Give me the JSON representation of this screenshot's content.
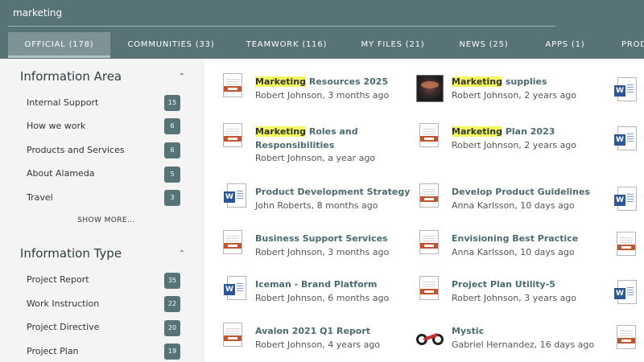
{
  "search": {
    "value": "marketing"
  },
  "tabs": [
    {
      "label": "OFFICIAL (178)"
    },
    {
      "label": "COMMUNITIES (33)"
    },
    {
      "label": "TEAMWORK (116)"
    },
    {
      "label": "MY FILES (21)"
    },
    {
      "label": "NEWS (25)"
    },
    {
      "label": "APPS (1)"
    },
    {
      "label": "PROD"
    }
  ],
  "sidebar": {
    "info_area": {
      "title": "Information Area",
      "items": [
        {
          "label": "Internal Support",
          "count": "15"
        },
        {
          "label": "How we work",
          "count": "6"
        },
        {
          "label": "Products and Services",
          "count": "6"
        },
        {
          "label": "About Alameda",
          "count": "5"
        },
        {
          "label": "Travel",
          "count": "3"
        }
      ],
      "show_more": "SHOW MORE..."
    },
    "info_type": {
      "title": "Information Type",
      "items": [
        {
          "label": "Project Report",
          "count": "35"
        },
        {
          "label": "Work Instruction",
          "count": "22"
        },
        {
          "label": "Project Directive",
          "count": "20"
        },
        {
          "label": "Project Plan",
          "count": "19"
        }
      ]
    }
  },
  "results": {
    "col1": [
      {
        "hl": "Marketing",
        "title": " Resources 2025",
        "meta": "Robert Johnson, 3 months ago",
        "icon": "pdf-icon"
      },
      {
        "hl": "Marketing",
        "title": " Roles and Responsibilities",
        "meta": "Robert Johnson, a year ago",
        "icon": "pdf-icon"
      },
      {
        "hl": "",
        "title": "Product Development Strategy",
        "meta": "John Roberts, 8 months ago",
        "icon": "word-icon"
      },
      {
        "hl": "",
        "title": "Business Support Services",
        "meta": "Robert Johnson, 3 months ago",
        "icon": "pdf-icon"
      },
      {
        "hl": "",
        "title": "Iceman - Brand Platform",
        "meta": "Robert Johnson, 6 months ago",
        "icon": "word-icon"
      },
      {
        "hl": "",
        "title": "Avalon 2021 Q1 Report",
        "meta": "Robert Johnson, 4 years ago",
        "icon": "pdf-icon"
      }
    ],
    "col2": [
      {
        "hl": "Marketing",
        "title": " supplies",
        "meta": "Robert Johnson, 2 years ago",
        "icon": "photo-icon"
      },
      {
        "hl": "Marketing",
        "title": " Plan 2023",
        "meta": "Robert Johnson, 2 years ago",
        "icon": "pdf-icon"
      },
      {
        "hl": "",
        "title": "Develop Product Guidelines",
        "meta": "Anna Karlsson, 10 days ago",
        "icon": "pdf-icon"
      },
      {
        "hl": "",
        "title": "Envisioning Best Practice",
        "meta": "Anna Karlsson, 10 days ago",
        "icon": "pdf-icon"
      },
      {
        "hl": "",
        "title": "Project Plan Utility-5",
        "meta": "Robert Johnson, 3 years ago",
        "icon": "pdf-icon"
      },
      {
        "hl": "",
        "title": "Mystic",
        "meta": "Gabriel Hernandez, 16 days ago",
        "icon": "bike-icon"
      }
    ],
    "col3_icons": [
      "word-icon",
      "word-icon",
      "word-icon",
      "pdf-icon",
      "word-icon",
      "pdf-icon"
    ]
  },
  "colors": {
    "header": "#587376",
    "active_tab": "#7d9396",
    "badge": "#587376",
    "highlight": "#f4f75d",
    "title": "#4b6b6e",
    "pdf_band": "#c0562f",
    "word_blue": "#2b5797"
  }
}
